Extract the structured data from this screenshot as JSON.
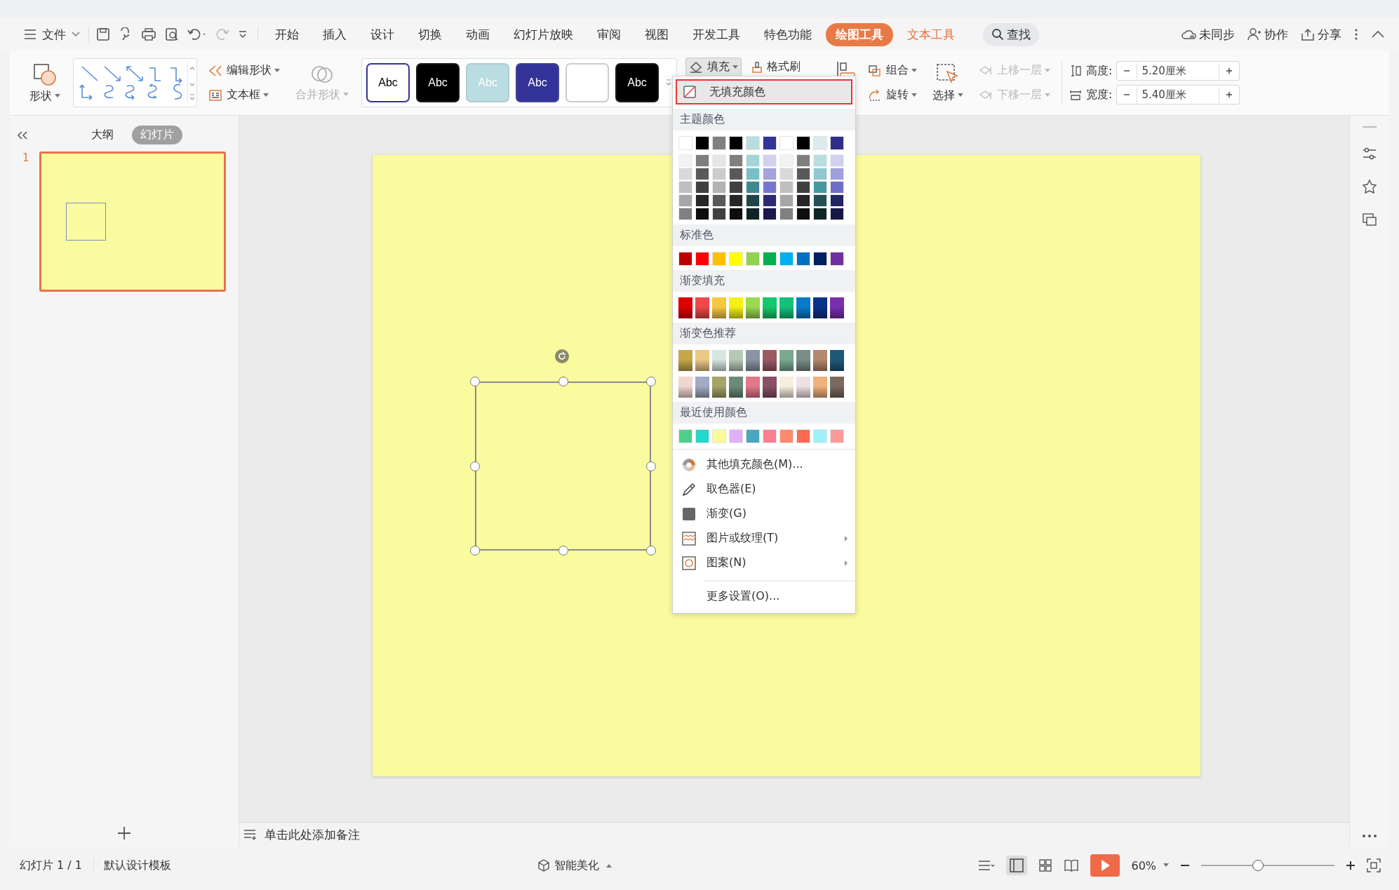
{
  "menu": {
    "file": "文件"
  },
  "tabs": [
    {
      "label": "开始",
      "selected": false,
      "kind": "normal"
    },
    {
      "label": "插入",
      "selected": false,
      "kind": "normal"
    },
    {
      "label": "设计",
      "selected": false,
      "kind": "normal"
    },
    {
      "label": "切换",
      "selected": false,
      "kind": "normal"
    },
    {
      "label": "动画",
      "selected": false,
      "kind": "normal"
    },
    {
      "label": "幻灯片放映",
      "selected": false,
      "kind": "normal"
    },
    {
      "label": "审阅",
      "selected": false,
      "kind": "normal"
    },
    {
      "label": "视图",
      "selected": false,
      "kind": "normal"
    },
    {
      "label": "开发工具",
      "selected": false,
      "kind": "normal"
    },
    {
      "label": "特色功能",
      "selected": false,
      "kind": "normal"
    },
    {
      "label": "绘图工具",
      "selected": true,
      "kind": "context"
    },
    {
      "label": "文本工具",
      "selected": false,
      "kind": "context"
    }
  ],
  "search": {
    "label": "查找"
  },
  "top_actions": [
    {
      "label": "未同步",
      "kind": "cloud"
    },
    {
      "label": "协作",
      "kind": "person"
    },
    {
      "label": "分享",
      "kind": "share"
    }
  ],
  "ribbon": {
    "shape": "形状",
    "edit_shape": "编辑形状",
    "text_box": "文本框",
    "merge_shape": {
      "label": "合并形状",
      "disabled": true
    },
    "styles": [
      {
        "label": "Abc",
        "color": "#ffffff",
        "kind": "outlined"
      },
      {
        "label": "Abc",
        "color": "#000000",
        "kind": "solid"
      },
      {
        "label": "Abc",
        "color": "#b9dde0",
        "kind": "solid"
      },
      {
        "label": "Abc",
        "color": "#333399",
        "kind": "solid"
      },
      {
        "color": "#ffffff",
        "kind": "blank"
      },
      {
        "label": "Abc",
        "color": "#000000",
        "kind": "solid"
      }
    ],
    "fill": {
      "label": "填充",
      "pressed": true
    },
    "format_painter": "格式刷",
    "group": "组合",
    "rotate": "旋转",
    "select": "选择",
    "bring_forward": {
      "label": "上移一层",
      "disabled": true
    },
    "send_backward": {
      "label": "下移一层",
      "disabled": true
    },
    "height": {
      "label": "高度:",
      "value": "5.20厘米"
    },
    "width": {
      "label": "宽度:",
      "value": "5.40厘米"
    }
  },
  "side_panel": {
    "tabs": [
      {
        "label": "大纲",
        "selected": false
      },
      {
        "label": "幻灯片",
        "selected": true
      }
    ],
    "slides": [
      {
        "number": "1",
        "selected": true
      }
    ]
  },
  "notes_placeholder": "单击此处添加备注",
  "fill_menu": {
    "no_fill": {
      "label": "无填充颜色",
      "highlighted": true
    },
    "theme_title": "主题颜色",
    "theme_colors": [
      {
        "color": "#ffffff",
        "shades": [
          {
            "color": "#f2f2f2"
          },
          {
            "color": "#d9d9d9"
          },
          {
            "color": "#bfbfbf"
          },
          {
            "color": "#a6a6a6"
          },
          {
            "color": "#808080"
          }
        ]
      },
      {
        "color": "#000000",
        "shades": [
          {
            "color": "#7f7f7f"
          },
          {
            "color": "#595959"
          },
          {
            "color": "#404040"
          },
          {
            "color": "#262626"
          },
          {
            "color": "#0d0d0d"
          }
        ]
      },
      {
        "color": "#808080",
        "shades": [
          {
            "color": "#e6e6e6"
          },
          {
            "color": "#cccccc"
          },
          {
            "color": "#b3b3b3"
          },
          {
            "color": "#595959"
          },
          {
            "color": "#404040"
          }
        ]
      },
      {
        "color": "#000000",
        "shades": [
          {
            "color": "#7f7f7f"
          },
          {
            "color": "#595959"
          },
          {
            "color": "#404040"
          },
          {
            "color": "#262626"
          },
          {
            "color": "#0d0d0d"
          }
        ]
      },
      {
        "color": "#b9dde0",
        "shades": [
          {
            "color": "#a3d4d8"
          },
          {
            "color": "#76c0c6"
          },
          {
            "color": "#3e8a90"
          },
          {
            "color": "#1f4548"
          },
          {
            "color": "#0f2224"
          }
        ]
      },
      {
        "color": "#333399",
        "shades": [
          {
            "color": "#d1d1ef"
          },
          {
            "color": "#a3a3df"
          },
          {
            "color": "#7676cf"
          },
          {
            "color": "#2a2a73"
          },
          {
            "color": "#1a1a4d"
          }
        ]
      },
      {
        "color": "#ffffff",
        "shades": [
          {
            "color": "#f2f2f2"
          },
          {
            "color": "#d9d9d9"
          },
          {
            "color": "#bfbfbf"
          },
          {
            "color": "#a6a6a6"
          },
          {
            "color": "#808080"
          }
        ]
      },
      {
        "color": "#000000",
        "shades": [
          {
            "color": "#7f7f7f"
          },
          {
            "color": "#595959"
          },
          {
            "color": "#404040"
          },
          {
            "color": "#262626"
          },
          {
            "color": "#0d0d0d"
          }
        ]
      },
      {
        "color": "#dbebee",
        "shades": [
          {
            "color": "#b9dde0"
          },
          {
            "color": "#8fc9cf"
          },
          {
            "color": "#449aa1"
          },
          {
            "color": "#254f54"
          },
          {
            "color": "#112528"
          }
        ]
      },
      {
        "color": "#2e2e8b",
        "shades": [
          {
            "color": "#d1d1ef"
          },
          {
            "color": "#a0a0dd"
          },
          {
            "color": "#6e6ecb"
          },
          {
            "color": "#232368"
          },
          {
            "color": "#171745"
          }
        ]
      }
    ],
    "standard_title": "标准色",
    "standard_colors": [
      {
        "color": "#c00000"
      },
      {
        "color": "#ff0000"
      },
      {
        "color": "#ffc000"
      },
      {
        "color": "#ffff00"
      },
      {
        "color": "#92d050"
      },
      {
        "color": "#00b050"
      },
      {
        "color": "#00b0f0"
      },
      {
        "color": "#0070c0"
      },
      {
        "color": "#002060"
      },
      {
        "color": "#7030a0"
      }
    ],
    "gradient_title": "渐变填充",
    "gradient_colors": [
      {
        "color": "#e00000"
      },
      {
        "color": "#f04848"
      },
      {
        "color": "#f5c842"
      },
      {
        "color": "#f5f016"
      },
      {
        "color": "#9ad950"
      },
      {
        "color": "#15c86a"
      },
      {
        "color": "#14c07a"
      },
      {
        "color": "#0a7acc"
      },
      {
        "color": "#0a3388"
      },
      {
        "color": "#7a2fae"
      }
    ],
    "recommended_title": "渐变色推荐",
    "recommended_colors": [
      {
        "color": "#c6a84a"
      },
      {
        "color": "#ecc785"
      },
      {
        "color": "#d8e6e0"
      },
      {
        "color": "#b6c8b6"
      },
      {
        "color": "#8a94a4"
      },
      {
        "color": "#9a5a64"
      },
      {
        "color": "#7aaa90"
      },
      {
        "color": "#7a8e88"
      },
      {
        "color": "#b48870"
      },
      {
        "color": "#1e5a78"
      },
      {
        "color": "#f2d6d2"
      },
      {
        "color": "#a2aac4"
      },
      {
        "color": "#a6a466"
      },
      {
        "color": "#6a8a7a"
      },
      {
        "color": "#e27888"
      },
      {
        "color": "#8a5066"
      },
      {
        "color": "#f8eee0"
      },
      {
        "color": "#f0e0e6"
      },
      {
        "color": "#f2b07a"
      },
      {
        "color": "#7a6a5e"
      }
    ],
    "recent_title": "最近使用颜色",
    "recent_colors": [
      {
        "color": "#4ed08c"
      },
      {
        "color": "#22d8c8"
      },
      {
        "color": "#fafa98"
      },
      {
        "color": "#e0b0f8"
      },
      {
        "color": "#4aa8bc"
      },
      {
        "color": "#fc8090"
      },
      {
        "color": "#fc8870"
      },
      {
        "color": "#fc6a50"
      },
      {
        "color": "#a0f0f8"
      },
      {
        "color": "#fc9a9a"
      }
    ],
    "commands": [
      {
        "label": "其他填充颜色(M)...",
        "kind": "palette",
        "submenu": false
      },
      {
        "label": "取色器(E)",
        "kind": "eyedropper",
        "submenu": false
      },
      {
        "label": "渐变(G)",
        "kind": "gradient",
        "submenu": false
      },
      {
        "label": "图片或纹理(T)",
        "kind": "texture",
        "submenu": true
      },
      {
        "label": "图案(N)",
        "kind": "pattern",
        "submenu": true
      }
    ],
    "more_settings": "更多设置(O)..."
  },
  "status_bar": {
    "slide": "幻灯片 1 / 1",
    "template": "默认设计模板",
    "beautify": "智能美化",
    "zoom": "60%",
    "zoom_slider": {
      "level": 0.42
    }
  }
}
